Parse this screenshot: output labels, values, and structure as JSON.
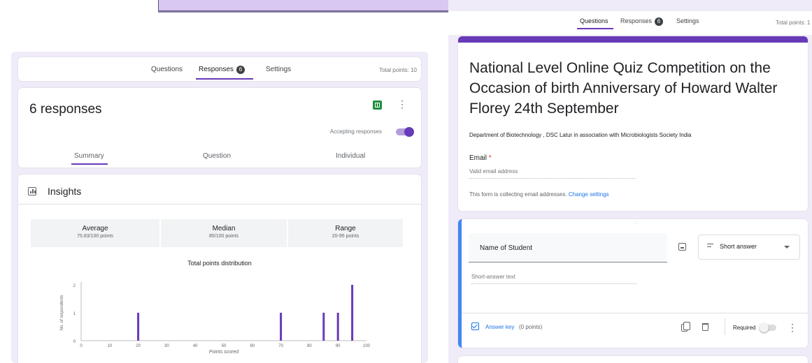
{
  "colors": {
    "accent": "#673ab7",
    "link": "#1a73e8",
    "focus": "#4285f4",
    "required": "#d93025",
    "background": "#f0ebf8",
    "sheets": "#1e8e3e"
  },
  "left_panel": {
    "tabs": {
      "questions": "Questions",
      "responses": "Responses",
      "responses_count": "6",
      "settings": "Settings"
    },
    "total_points": "Total points: 10",
    "responses": {
      "count_label": "6 responses",
      "accepting_label": "Accepting responses",
      "accepting": true,
      "subtabs": {
        "summary": "Summary",
        "question": "Question",
        "individual": "Individual"
      }
    },
    "insights": {
      "title": "Insights",
      "stats": [
        {
          "label": "Average",
          "value": "75.83/100 points"
        },
        {
          "label": "Median",
          "value": "85/100 points"
        },
        {
          "label": "Range",
          "value": "20-95 points"
        }
      ]
    }
  },
  "chart_data": {
    "type": "bar",
    "title": "Total points distribution",
    "xlabel": "Points scored",
    "ylabel": "No. of respondents",
    "x": [
      20,
      70,
      85,
      90,
      95
    ],
    "values": [
      1,
      1,
      1,
      1,
      2
    ],
    "xlim": [
      0,
      100
    ],
    "ylim": [
      0,
      2
    ],
    "xticks": [
      0,
      10,
      20,
      30,
      40,
      50,
      60,
      70,
      80,
      90,
      100
    ],
    "yticks": [
      0,
      1,
      2
    ],
    "color": "#673ab7",
    "grid": false
  },
  "right_panel": {
    "tabs": {
      "questions": "Questions",
      "responses": "Responses",
      "responses_count": "6",
      "settings": "Settings"
    },
    "total_points": "Total points: 1",
    "form": {
      "title": "National Level Online Quiz Competition on the Occasion of birth Anniversary of Howard Walter Florey 24th September",
      "description": "Department of Biotechnology , DSC Latur in association with Microbiologists Society India",
      "email_label": "Email",
      "required_mark": "*",
      "email_placeholder": "Valid email address",
      "collect_note": "This form is collecting email addresses.",
      "change_settings": "Change settings"
    },
    "question": {
      "drag_handle": ":::",
      "title": "Name of Student",
      "type": "Short answer",
      "answer_placeholder": "Short-answer text",
      "answer_key": "Answer key",
      "points": "(0 points)",
      "required_label": "Required",
      "required": false
    }
  }
}
